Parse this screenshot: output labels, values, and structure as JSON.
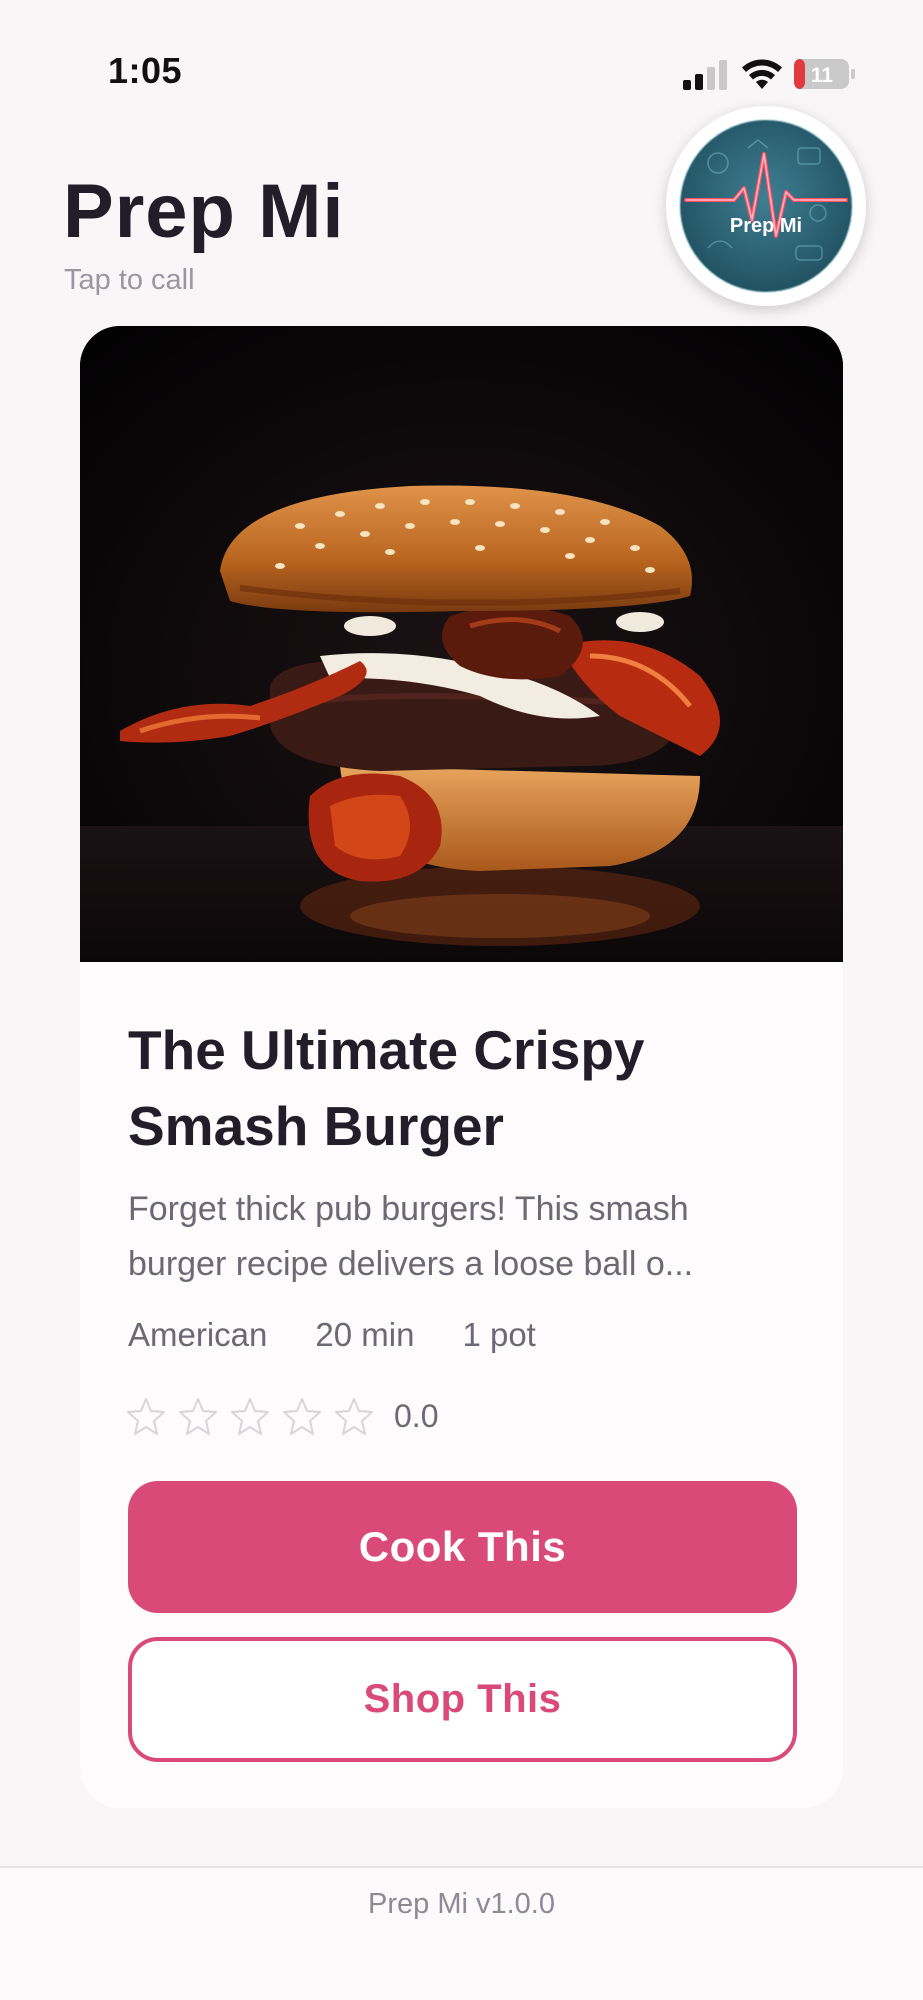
{
  "status_bar": {
    "time": "1:05",
    "battery_level": "11",
    "signal_icon": "cellular-signal-icon",
    "wifi_icon": "wifi-icon",
    "battery_icon": "battery-icon"
  },
  "header": {
    "title": "Prep Mi",
    "subtitle": "Tap to call",
    "logo_text": "Prep Mi"
  },
  "recipe": {
    "image_icon": "burger-photo",
    "title": "The Ultimate Crispy Smash Burger",
    "description_line1": "Forget thick pub burgers! This smash",
    "description_line2": "burger recipe delivers a loose ball o...",
    "cuisine": "American",
    "time": "20 min",
    "equipment": "1 pot",
    "rating": "0.0",
    "rating_stars": 0,
    "rating_max": 5
  },
  "actions": {
    "cook_label": "Cook This",
    "shop_label": "Shop This"
  },
  "footer": {
    "version": "Prep Mi v1.0.0"
  },
  "colors": {
    "accent": "#d94a78",
    "background": "#f9f6f7",
    "text_dark": "#231d29",
    "text_muted": "#6d6872"
  }
}
